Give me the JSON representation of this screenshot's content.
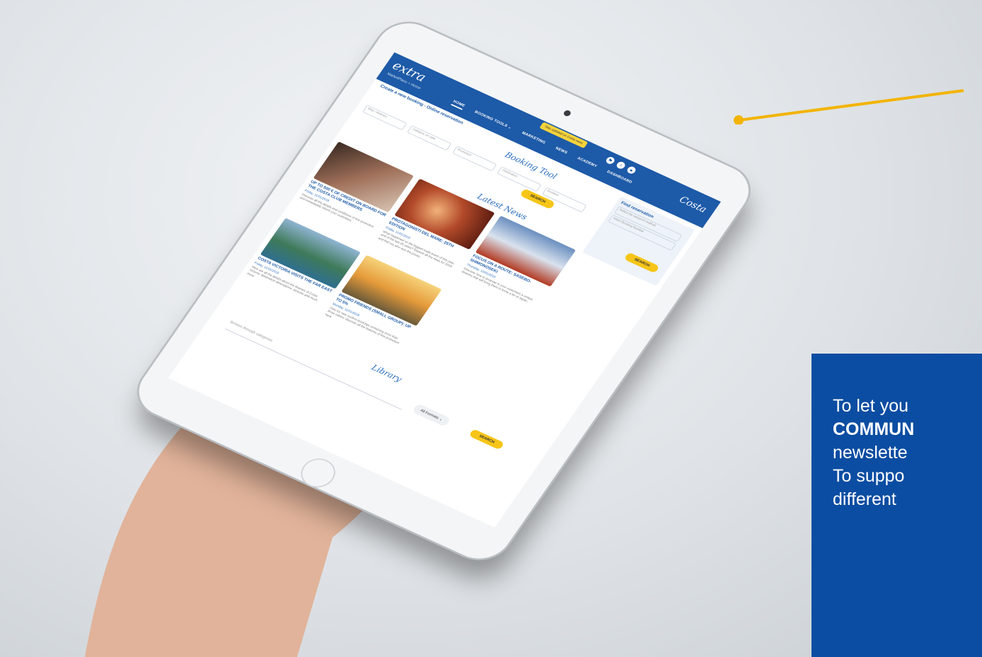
{
  "app": {
    "logo": "extra",
    "brand": "Costa",
    "breadcrumb": "MarketPlace > Home",
    "tooltip": "Stay updated on Costa news",
    "nav": [
      "HOME",
      "BOOKING TOOLS ⌄",
      "MARKETING",
      "NEWS",
      "ACADEMY",
      "DASHBOARD"
    ],
    "active_nav": "HOME"
  },
  "booking": {
    "section_title": "Booking Tool",
    "heading": "Create a new booking - Online reservation",
    "fields": [
      "Ship / Itinerary",
      "Category on sale",
      "Promotion",
      "Destination",
      "Duration"
    ],
    "search_label": "SEARCH"
  },
  "find_reservation": {
    "title": "Find reservation",
    "method": "Select the research method",
    "booking_number": "Insert Booking Number",
    "search_label": "SEARCH"
  },
  "news": {
    "section_title": "Latest News",
    "cards": [
      {
        "title": "UP TO 500 € OF CREDIT ON BOARD FOR THE COSTA CLUB MEMBERS",
        "date": "Friday, 11/01/2019",
        "desc": "Discover all the details and conditions of this promotion and immediately inform your customers."
      },
      {
        "title": "PROTAGONISTI DEL MARE: 25TH EDITION",
        "date": "Friday, 11/01/2019",
        "desc": "What happened on the biggest trade event of this year, and of the last 25 years? Explore all the news for 2019 and find out who won the prizes."
      },
      {
        "title": "FOCUS ON A ROUTE: SASEBO-SHIMONOSEKI",
        "date": "Thursday, 10/01/2019",
        "desc": "Discover how to propose to your customers a unique itinerary that will bring them to know a bit of Japan."
      },
      {
        "title": "COSTA VICTORIA VISITS THE FAR EAST",
        "date": "Friday, 11/01/2019",
        "desc": "Here are all the details about the itinerary of Costa Victoria: destination descriptions, pictures and much more."
      },
      {
        "title": "PROMO FRIENDS (SMALL GROUP): UP TO 5%",
        "date": "Monday, 11/01/2019",
        "desc": "Only for new confirm bookings containing more than three cabins: discover all the features of this promotion here."
      }
    ]
  },
  "library": {
    "section_title": "Library",
    "placeholder": "Browse through categories",
    "format_select": "All Formats ⌄",
    "search_label": "SEARCH"
  },
  "infobox": {
    "line1": "To let you",
    "line2_bold": "COMMUN",
    "line3": "newslette",
    "line4": "To suppo",
    "line5": "different"
  },
  "colors": {
    "brand_blue": "#1d5aa8",
    "accent_yellow": "#f6c518",
    "infobox_blue": "#0b4da2",
    "pointer_orange": "#f3b400"
  }
}
